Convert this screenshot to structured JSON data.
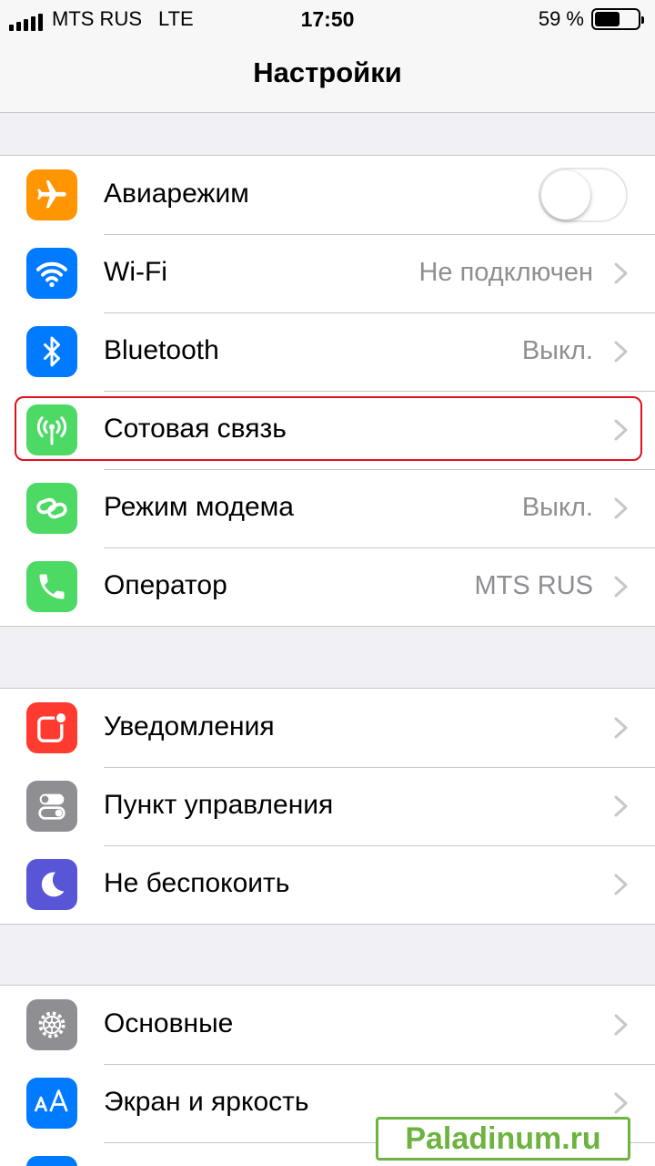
{
  "status_bar": {
    "carrier": "MTS RUS",
    "network": "LTE",
    "time": "17:50",
    "battery": "59 %",
    "battery_level": 0.59
  },
  "nav": {
    "title": "Настройки"
  },
  "groups": [
    {
      "rows": [
        {
          "label": "Авиарежим",
          "icon": "airplane-icon",
          "icon_color": "#ff9500",
          "toggle": false
        },
        {
          "label": "Wi-Fi",
          "value": "Не подключен",
          "icon": "wifi-icon",
          "icon_color": "#007aff"
        },
        {
          "label": "Bluetooth",
          "value": "Выкл.",
          "icon": "bluetooth-icon",
          "icon_color": "#007aff"
        },
        {
          "label": "Сотовая связь",
          "icon": "antenna-icon",
          "icon_color": "#4cd964",
          "highlighted": true
        },
        {
          "label": "Режим модема",
          "value": "Выкл.",
          "icon": "hotspot-icon",
          "icon_color": "#4cd964"
        },
        {
          "label": "Оператор",
          "value": "MTS RUS",
          "icon": "phone-icon",
          "icon_color": "#4cd964"
        }
      ]
    },
    {
      "rows": [
        {
          "label": "Уведомления",
          "icon": "notifications-icon",
          "icon_color": "#ff3b30"
        },
        {
          "label": "Пункт управления",
          "icon": "control-center-icon",
          "icon_color": "#8e8e93"
        },
        {
          "label": "Не беспокоить",
          "icon": "moon-icon",
          "icon_color": "#5856d6"
        }
      ]
    },
    {
      "rows": [
        {
          "label": "Основные",
          "icon": "gear-icon",
          "icon_color": "#8e8e93"
        },
        {
          "label": "Экран и яркость",
          "icon": "text-size-icon",
          "icon_color": "#007aff"
        }
      ]
    }
  ],
  "highlight_color": "#e0101e",
  "watermark": {
    "text": "Paladinum.ru",
    "color": "#6db33f"
  }
}
